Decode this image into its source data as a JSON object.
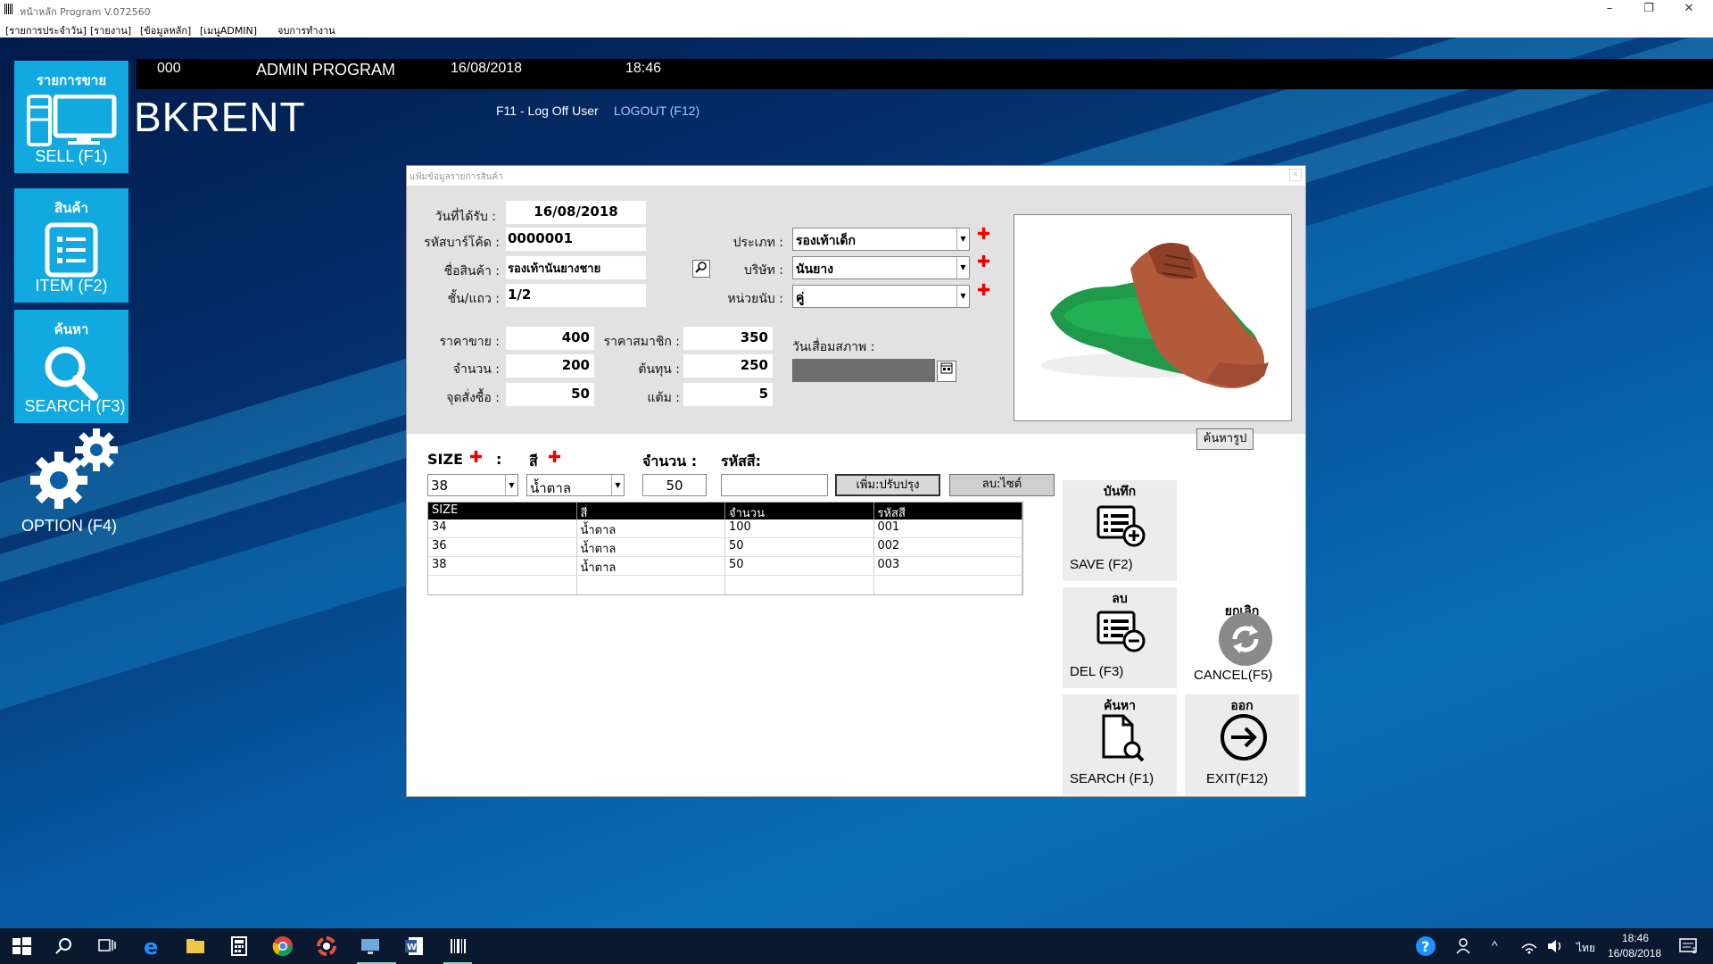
{
  "window": {
    "title": "หน้าหลัก Program V.072560",
    "min": "–",
    "restore": "❐",
    "close": "✕"
  },
  "menu": [
    "[รายการประจำวัน]",
    "[รายงาน]",
    "[ข้อมูลหลัก]",
    "[เมนูADMIN]",
    "จบการทำงาน"
  ],
  "header": {
    "code": "000",
    "program": "ADMIN PROGRAM",
    "date": "16/08/2018",
    "time": "18:46",
    "brand": "BKRENT",
    "logoff": "F11 - Log Off User",
    "logout": "LOGOUT (F12)"
  },
  "sidebar": {
    "sell": {
      "head": "รายการขาย",
      "label": "SELL (F1)"
    },
    "item": {
      "head": "สินค้า",
      "label": "ITEM (F2)"
    },
    "search": {
      "head": "ค้นหา",
      "label": "SEARCH (F3)"
    },
    "option": {
      "label": "OPTION (F4)"
    }
  },
  "dialog": {
    "title": "แฟ้มข้อมูลรายการสินค้า",
    "close": "✕",
    "labels": {
      "received_date": "วันที่ได้รับ :",
      "barcode": "รหัสบาร์โค้ด :",
      "name": "ชื่อสินค้า :",
      "shelf": "ชั้น/แถว :",
      "price": "ราคาขาย :",
      "member_price": "ราคาสมาชิก :",
      "qty": "จำนวน :",
      "cost": "ต้นทุน :",
      "reorder": "จุดสั่งซื้อ :",
      "points": "แต้ม :",
      "type": "ประเภท :",
      "company": "บริษัท :",
      "unit": "หน่วยนับ :",
      "expiry": "วันเสื่อมสภาพ :"
    },
    "values": {
      "received_date": "16/08/2018",
      "barcode": "0000001",
      "name": "รองเท้านันยางชาย",
      "shelf": "1/2",
      "price": "400",
      "member_price": "350",
      "qty": "200",
      "cost": "250",
      "reorder": "50",
      "points": "5",
      "type": "รองเท้าเด็ก",
      "company": "นันยาง",
      "unit": "คู่"
    },
    "find_image_button": "ค้นหารูป",
    "size_section": {
      "size_label": "SIZE",
      "colon": ":",
      "color_label": "สี",
      "qty_label": "จำนวน :",
      "code_label": "รหัสสี:",
      "size_value": "38",
      "color_value": "น้ำตาล",
      "qty_value": "50",
      "code_value": "",
      "add_button": "เพิ่ม:ปรับปรุง",
      "delete_button": "ลบ:ไซต์"
    },
    "table": {
      "columns": [
        "SIZE",
        "สี",
        "จำนวน",
        "รหัสสี"
      ],
      "rows": [
        [
          "34",
          "น้ำตาล",
          "100",
          "001"
        ],
        [
          "36",
          "น้ำตาล",
          "50",
          "002"
        ],
        [
          "38",
          "น้ำตาล",
          "50",
          "003"
        ],
        [
          "",
          "",
          "",
          ""
        ]
      ]
    },
    "actions": {
      "save": {
        "head": "บันทึก",
        "label": "SAVE (F2)"
      },
      "del": {
        "head": "ลบ",
        "label": "DEL (F3)"
      },
      "cancel": {
        "head": "ยกเลิก",
        "label": "CANCEL(F5)"
      },
      "search": {
        "head": "ค้นหา",
        "label": "SEARCH (F1)"
      },
      "exit": {
        "head": "ออก",
        "label": "EXIT(F12)"
      }
    }
  },
  "taskbar": {
    "lang": "ไทย",
    "time": "18:46",
    "date": "16/08/2018",
    "notif": "1"
  },
  "colors": {
    "tile": "#11a9e0",
    "accent_link": "#9fd0ff",
    "required": "#e00000"
  }
}
